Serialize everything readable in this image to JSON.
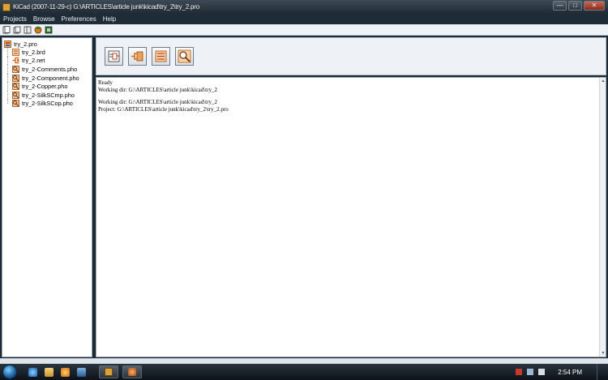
{
  "window": {
    "title": "KiCad (2007-11-29-c) G:\\ARTICLES\\article junk\\kicad\\try_2\\try_2.pro",
    "controls": [
      "minimize",
      "maximize",
      "close"
    ]
  },
  "menubar": {
    "items": [
      "Projects",
      "Browse",
      "Preferences",
      "Help"
    ]
  },
  "toolbar": {
    "icons": [
      "new-project-icon",
      "open-project-icon",
      "save-project-icon",
      "archive-icon",
      "unarchive-icon"
    ]
  },
  "tree": {
    "root": "try_2.pro",
    "items": [
      {
        "label": "try_2.brd",
        "icon": "pcb-file-icon"
      },
      {
        "label": "try_2.net",
        "icon": "netlist-file-icon"
      },
      {
        "label": "try_2-Comments.pho",
        "icon": "gerber-file-icon"
      },
      {
        "label": "try_2-Component.pho",
        "icon": "gerber-file-icon"
      },
      {
        "label": "try_2-Copper.pho",
        "icon": "gerber-file-icon"
      },
      {
        "label": "try_2-SilkSCmp.pho",
        "icon": "gerber-file-icon"
      },
      {
        "label": "try_2-SilkSCop.pho",
        "icon": "gerber-file-icon"
      }
    ]
  },
  "launchers": [
    "eeschema-icon",
    "cvpcb-icon",
    "pcbnew-icon",
    "gerbview-icon"
  ],
  "output": {
    "lines": [
      "Ready",
      "Working dir: G:\\ARTICLES\\article junk\\kicad\\try_2",
      "",
      "Working dir: G:\\ARTICLES\\article junk\\kicad\\try_2",
      "Project: G:\\ARTICLES\\article junk\\kicad\\try_2\\try_2.pro"
    ]
  },
  "taskbar": {
    "clock": "2:54 PM",
    "quick_launch": [
      "ie-icon",
      "explorer-icon",
      "media-icon",
      "switch-windows-icon"
    ],
    "tasks": [
      "kicad-task-icon",
      "gimp-task-icon"
    ],
    "tray": [
      "security-icon",
      "network-icon",
      "volume-icon"
    ]
  },
  "colors": {
    "accent_orange": "#d66a1e",
    "panel_bg": "#eef2f6"
  }
}
